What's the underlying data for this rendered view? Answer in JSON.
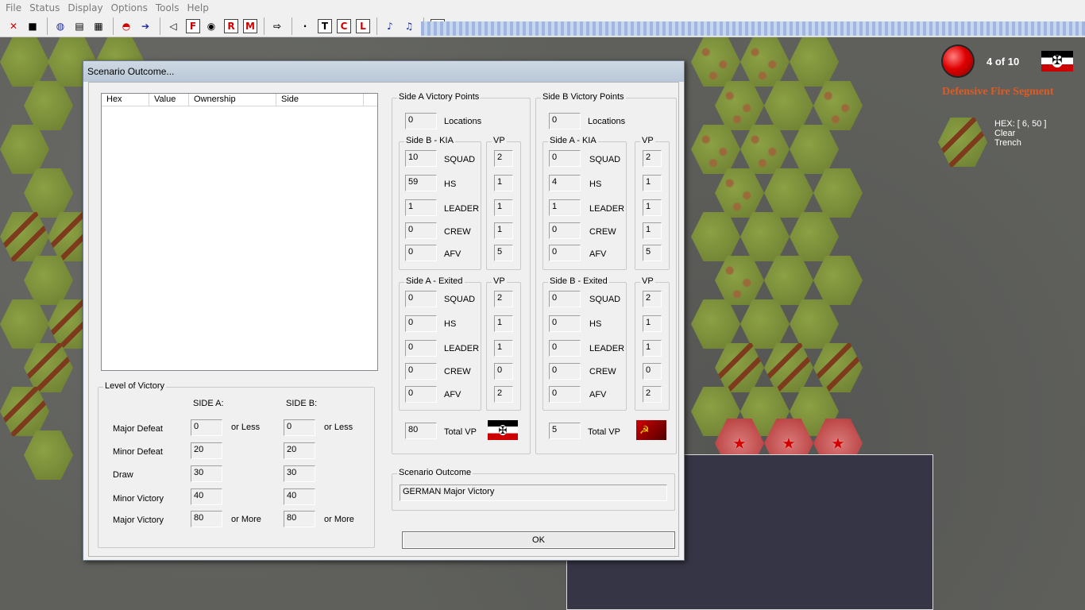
{
  "menu": [
    "File",
    "Status",
    "Display",
    "Options",
    "Tools",
    "Help"
  ],
  "toolbar": {
    "icons": [
      "close-x-icon",
      "save-icon",
      "globe-icon",
      "map-icon",
      "grid-icon",
      "turn-icon",
      "advance-icon",
      "back-icon",
      "fire-icon",
      "eye-icon",
      "rout-icon",
      "move-icon",
      "arrow-icon",
      "dot-icon",
      "text-icon",
      "c-icon",
      "l-icon",
      "fx-icon",
      "music-icon",
      "zoom-icon"
    ],
    "btn_F": "F",
    "btn_R": "R",
    "btn_M": "M",
    "btn_T": "T",
    "btn_C": "C",
    "btn_L": "L",
    "btn_dot": "·"
  },
  "info": {
    "turn": "4 of 10",
    "phase": "Defensive Fire Segment",
    "hex_coord": "HEX: [ 6, 50 ]",
    "hex_terrain1": "Clear",
    "hex_terrain2": "Trench"
  },
  "dialog": {
    "title": "Scenario Outcome...",
    "list_columns": [
      "Hex",
      "Value",
      "Ownership",
      "Side"
    ],
    "level_of_victory": {
      "label": "Level of Victory",
      "side_a_label": "SIDE A:",
      "side_b_label": "SIDE B:",
      "rows": [
        {
          "label": "Major Defeat",
          "a": "0",
          "b": "0",
          "suffix": "or Less"
        },
        {
          "label": "Minor Defeat",
          "a": "20",
          "b": "20",
          "suffix": ""
        },
        {
          "label": "Draw",
          "a": "30",
          "b": "30",
          "suffix": ""
        },
        {
          "label": "Minor Victory",
          "a": "40",
          "b": "40",
          "suffix": ""
        },
        {
          "label": "Major Victory",
          "a": "80",
          "b": "80",
          "suffix": "or More"
        }
      ]
    },
    "side_a": {
      "title": "Side A Victory Points",
      "locations": "0",
      "locations_label": "Locations",
      "kia_title": "Side B - KIA",
      "exited_title": "Side A - Exited",
      "vp_label": "VP",
      "kia": [
        {
          "label": "SQUAD",
          "count": "10",
          "vp": "2"
        },
        {
          "label": "HS",
          "count": "59",
          "vp": "1"
        },
        {
          "label": "LEADER",
          "count": "1",
          "vp": "1"
        },
        {
          "label": "CREW",
          "count": "0",
          "vp": "1"
        },
        {
          "label": "AFV",
          "count": "0",
          "vp": "5"
        }
      ],
      "exited": [
        {
          "label": "SQUAD",
          "count": "0",
          "vp": "2"
        },
        {
          "label": "HS",
          "count": "0",
          "vp": "1"
        },
        {
          "label": "LEADER",
          "count": "0",
          "vp": "1"
        },
        {
          "label": "CREW",
          "count": "0",
          "vp": "0"
        },
        {
          "label": "AFV",
          "count": "0",
          "vp": "2"
        }
      ],
      "total": "80",
      "total_label": "Total VP"
    },
    "side_b": {
      "title": "Side B Victory Points",
      "locations": "0",
      "locations_label": "Locations",
      "kia_title": "Side A - KIA",
      "exited_title": "Side B - Exited",
      "vp_label": "VP",
      "kia": [
        {
          "label": "SQUAD",
          "count": "0",
          "vp": "2"
        },
        {
          "label": "HS",
          "count": "4",
          "vp": "1"
        },
        {
          "label": "LEADER",
          "count": "1",
          "vp": "1"
        },
        {
          "label": "CREW",
          "count": "0",
          "vp": "1"
        },
        {
          "label": "AFV",
          "count": "0",
          "vp": "5"
        }
      ],
      "exited": [
        {
          "label": "SQUAD",
          "count": "0",
          "vp": "2"
        },
        {
          "label": "HS",
          "count": "0",
          "vp": "1"
        },
        {
          "label": "LEADER",
          "count": "0",
          "vp": "1"
        },
        {
          "label": "CREW",
          "count": "0",
          "vp": "0"
        },
        {
          "label": "AFV",
          "count": "0",
          "vp": "2"
        }
      ],
      "total": "5",
      "total_label": "Total VP"
    },
    "outcome_title": "Scenario Outcome",
    "outcome": "GERMAN Major Victory",
    "ok": "OK"
  }
}
